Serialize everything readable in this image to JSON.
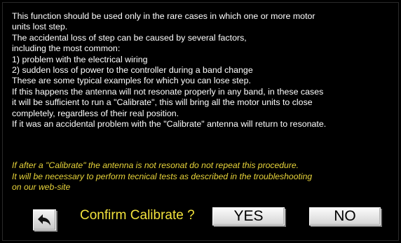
{
  "info": {
    "lines": [
      "This function should be used only in the rare cases in which one or more motor",
      "units lost step.",
      "The accidental loss of step can be caused by several factors,",
      "including the most common:",
      "1) problem with the electrical wiring",
      "2) sudden loss of power to the controller during a band change",
      "These are some typical examples for which you can lose step.",
      "If this happens the antenna will not resonate properly in any band, in these cases",
      "it will be sufficient to run a \"Calibrate\", this will bring all the motor units to close",
      "completely, regardless of their real position.",
      "If it was an accidental problem with the \"Calibrate\" antenna will return to resonate."
    ]
  },
  "warning": {
    "lines": [
      "If after a \"Calibrate\" the antenna is not resonat do not repeat this procedure.",
      "It will be necessary to perform tecnical tests as described in the troubleshooting",
      "on our web-site"
    ]
  },
  "confirm": {
    "label": "Confirm Calibrate ?",
    "yes_label": "YES",
    "no_label": "NO"
  },
  "icons": {
    "back": "back-arrow-icon"
  },
  "colors": {
    "background": "#000000",
    "text": "#ffffff",
    "warning_text": "#e8d43a",
    "confirm_text": "#f2e23c"
  }
}
